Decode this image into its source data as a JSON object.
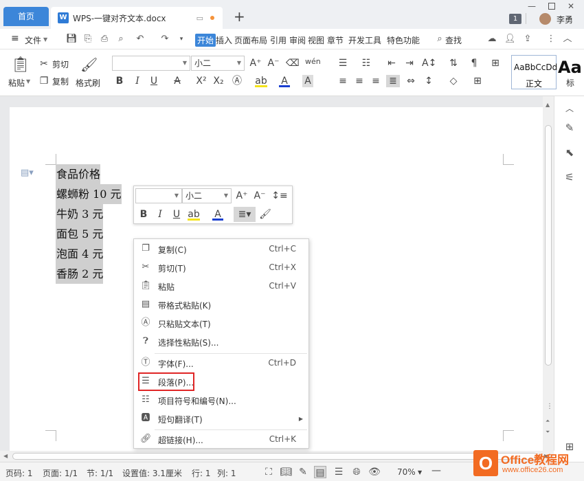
{
  "titlebar": {
    "home_tab": "首页",
    "doc_tab_icon": "W",
    "doc_tab_title": "WPS-一键对齐文本.docx",
    "new_tab": "+",
    "badge_count": "1",
    "user_name": "李勇"
  },
  "menubar": {
    "menu_icon": "≡",
    "file_label": "文件",
    "tabs": [
      "开始",
      "插入",
      "页面布局",
      "引用",
      "审阅",
      "视图",
      "章节",
      "开发工具",
      "特色功能"
    ],
    "active_tab": "开始",
    "search_label": "查找"
  },
  "ribbon": {
    "paste_label": "粘贴",
    "cut_label": "剪切",
    "copy_label": "复制",
    "format_painter_label": "格式刷",
    "font_name": "",
    "font_size": "小二",
    "style_preview": "AaBbCcDd",
    "style_name": "正文",
    "style2_preview": "Aa",
    "style2_name": "标"
  },
  "document": {
    "lines": [
      "食品价格",
      "螺蛳粉 10 元",
      "牛奶 3 元",
      "面包 5 元",
      "泡面 4 元",
      "香肠 2 元"
    ]
  },
  "mini_toolbar": {
    "font_name": "",
    "font_size": "小二"
  },
  "context_menu": {
    "items": [
      {
        "icon": "copy-icon",
        "label": "复制(C)",
        "shortcut": "Ctrl+C"
      },
      {
        "icon": "scissors-icon",
        "label": "剪切(T)",
        "shortcut": "Ctrl+X"
      },
      {
        "icon": "paste-icon",
        "label": "粘贴",
        "shortcut": "Ctrl+V"
      },
      {
        "icon": "paste-format-icon",
        "label": "带格式粘贴(K)",
        "shortcut": ""
      },
      {
        "icon": "paste-text-icon",
        "label": "只粘贴文本(T)",
        "shortcut": ""
      },
      {
        "icon": "paste-special-icon",
        "label": "选择性粘贴(S)...",
        "shortcut": ""
      },
      {
        "icon": "font-icon",
        "label": "字体(F)...",
        "shortcut": "Ctrl+D"
      },
      {
        "icon": "paragraph-icon",
        "label": "段落(P)...",
        "shortcut": ""
      },
      {
        "icon": "list-icon",
        "label": "项目符号和编号(N)...",
        "shortcut": ""
      },
      {
        "icon": "translate-icon",
        "label": "短句翻译(T)",
        "shortcut": ""
      },
      {
        "icon": "link-icon",
        "label": "超链接(H)...",
        "shortcut": "Ctrl+K"
      }
    ],
    "highlighted_item": "段落(P)...",
    "highlight_color": "#e02525"
  },
  "statusbar": {
    "page_num": "页码: 1",
    "pages": "页面: 1/1",
    "section": "节: 1/1",
    "setting": "设置值: 3.1厘米",
    "row": "行: 1",
    "col": "列: 1",
    "zoom": "70%"
  },
  "watermark": {
    "brand": "Office教程网",
    "url": "www.office26.com"
  },
  "colors": {
    "accent": "#3c86d9",
    "logo_orange": "#f26b22"
  }
}
